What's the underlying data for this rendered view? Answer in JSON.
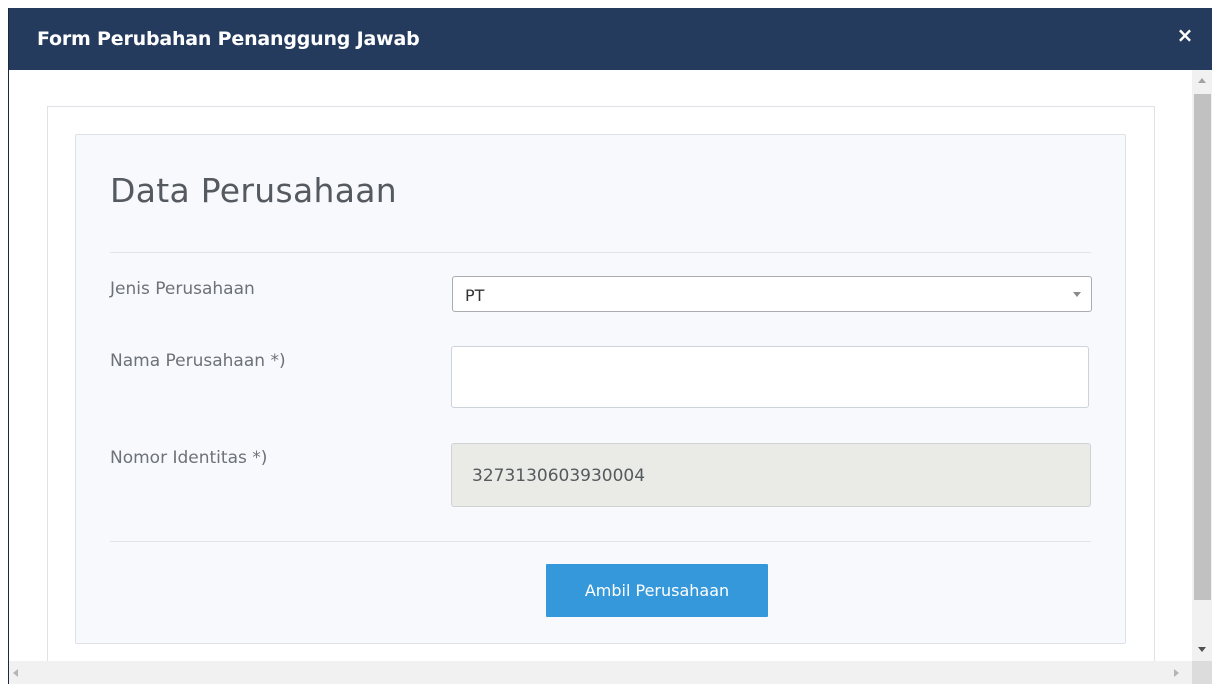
{
  "modal": {
    "title": "Form Perubahan Penanggung Jawab",
    "close_label": "×"
  },
  "form": {
    "section_title": "Data Perusahaan",
    "jenis_perusahaan": {
      "label": "Jenis Perusahaan",
      "selected_value": "PT"
    },
    "nama_perusahaan": {
      "label": "Nama Perusahaan *)",
      "value": "",
      "placeholder": ""
    },
    "nomor_identitas": {
      "label": "Nomor Identitas *)",
      "value": "3273130603930004"
    },
    "submit_label": "Ambil Perusahaan"
  },
  "colors": {
    "header_bg": "#243b5d",
    "primary_button": "#3498db",
    "readonly_bg": "#eaeae6",
    "panel_bg": "#f7f9fc"
  },
  "icons": {
    "close": "close-icon",
    "select_arrow": "chevron-down-icon"
  }
}
